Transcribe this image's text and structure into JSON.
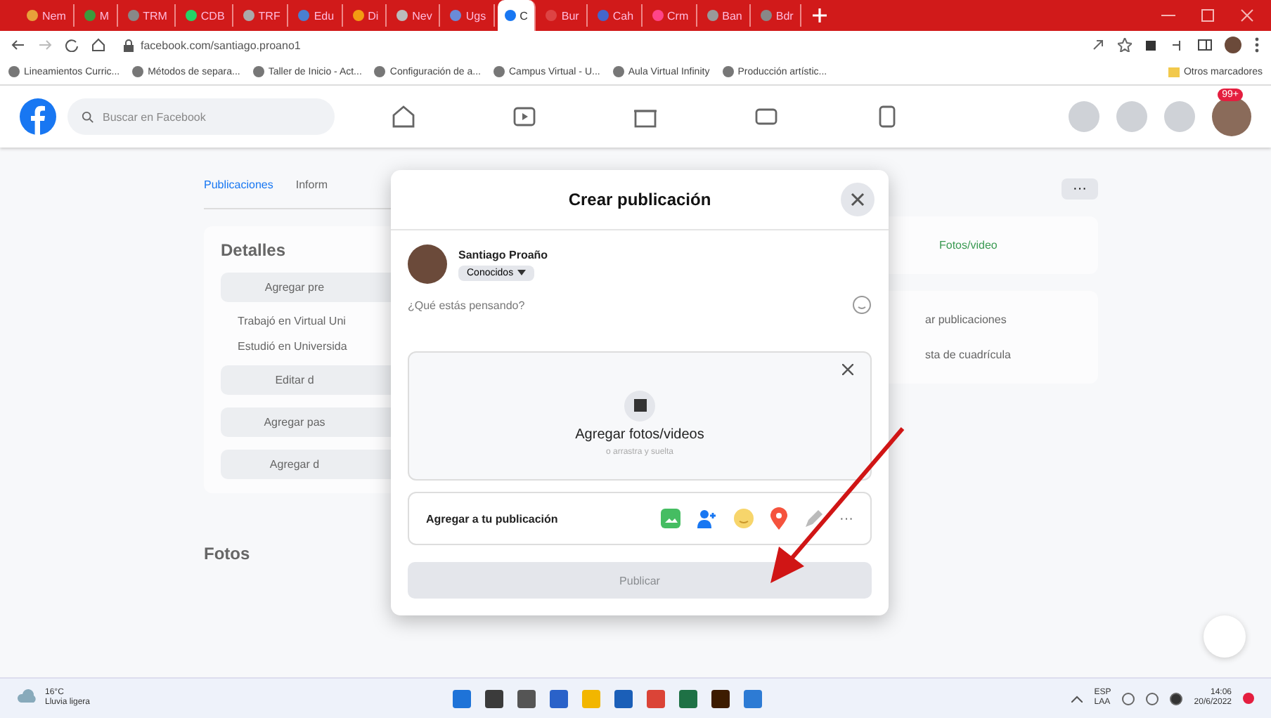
{
  "browser": {
    "tabs": [
      {
        "label": "Nem",
        "selected": false
      },
      {
        "label": "M",
        "selected": false
      },
      {
        "label": "TRM",
        "selected": false
      },
      {
        "label": "CDB",
        "selected": false
      },
      {
        "label": "TRF",
        "selected": false
      },
      {
        "label": "Edu",
        "selected": false
      },
      {
        "label": "Di",
        "selected": false
      },
      {
        "label": "Nev",
        "selected": false
      },
      {
        "label": "Ugs",
        "selected": false
      },
      {
        "label": "C",
        "selected": true
      },
      {
        "label": "Bur",
        "selected": false
      },
      {
        "label": "Cah",
        "selected": false
      },
      {
        "label": "Crm",
        "selected": false
      },
      {
        "label": "Ban",
        "selected": false
      },
      {
        "label": "Bdr",
        "selected": false
      }
    ],
    "url": "facebook.com/santiago.proano1",
    "bookmarks": [
      "Lineamientos Curric...",
      "Métodos de separa...",
      "Taller de Inicio - Act...",
      "Configuración de a...",
      "Campus Virtual - U...",
      "Aula Virtual Infinity",
      "Producción artístic..."
    ],
    "other_bookmarks": "Otros marcadores"
  },
  "facebook": {
    "search_placeholder": "Buscar en Facebook",
    "notification_badge": "99+",
    "profile_tabs": [
      "Publicaciones",
      "Inform"
    ],
    "more": "···",
    "details_title": "Detalles",
    "details_buttons": [
      "Agregar pre",
      "Editar d",
      "Agregar pas",
      "Agregar d"
    ],
    "details_items": [
      "Trabajó en Virtual Uni",
      "Estudió en Universida"
    ],
    "photos_title": "Fotos",
    "right_items": [
      "Fotos/video",
      "ar publicaciones",
      "sta de cuadrícula"
    ]
  },
  "dialog": {
    "title": "Crear publicación",
    "author": "Santiago Proaño",
    "audience": "Conocidos",
    "placeholder": "¿Qué estás pensando?",
    "media_label": "Agregar fotos/videos",
    "media_hint": "o arrastra y suelta",
    "add_label": "Agregar a tu publicación",
    "more": "···",
    "publish": {
      "label": "Publicar",
      "disabled": true
    }
  },
  "taskbar": {
    "temperature": "16°C",
    "weather": "Lluvia ligera",
    "language": "ESP",
    "layout": "LAA",
    "time": "14:06",
    "date": "20/6/2022"
  }
}
